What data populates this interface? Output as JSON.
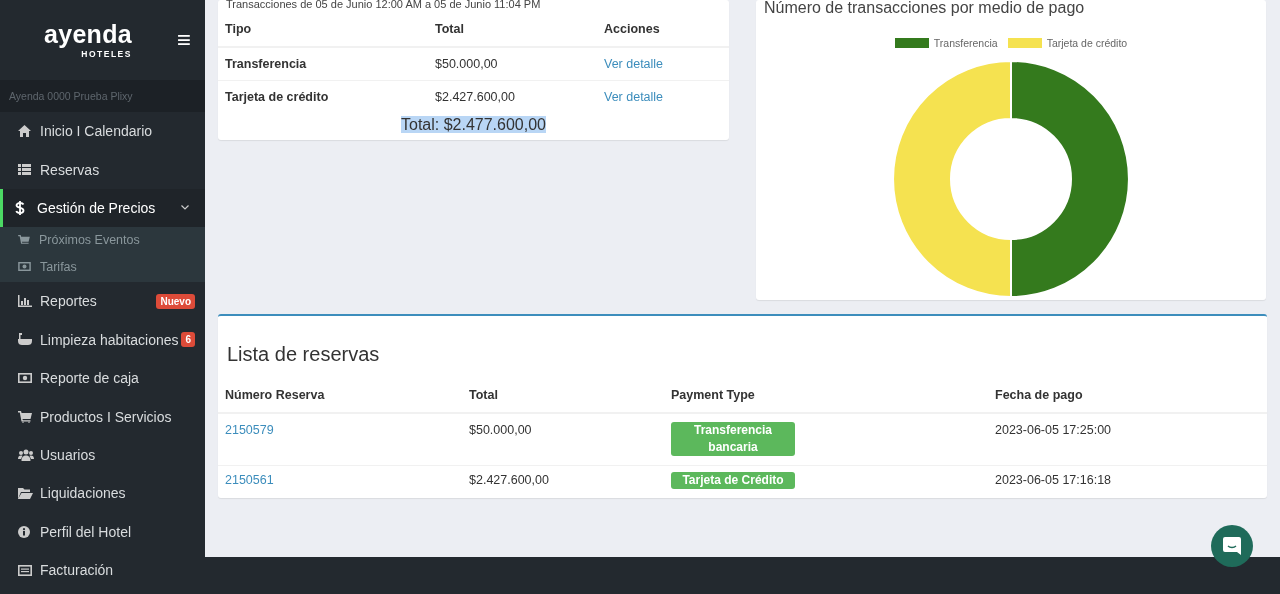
{
  "sidebar": {
    "logo": {
      "name": "ayenda",
      "sub": "HOTELES"
    },
    "menu_icon": "≡",
    "hotel": "Ayenda 0000 Prueba Plixy",
    "items": [
      {
        "label": "Inicio I Calendario",
        "selected": false
      },
      {
        "label": "Reservas",
        "selected": false
      },
      {
        "label": "Gestión de Precios",
        "selected": true,
        "expanded": true,
        "children": [
          {
            "label": "Próximos Eventos"
          },
          {
            "label": "Tarifas"
          }
        ]
      },
      {
        "label": "Reportes",
        "selected": false,
        "badge": "Nuevo"
      },
      {
        "label": "Limpieza habitaciones",
        "selected": false,
        "badge": "6"
      },
      {
        "label": "Reporte de caja",
        "selected": false
      },
      {
        "label": "Productos I Servicios",
        "selected": false
      },
      {
        "label": "Usuarios",
        "selected": false
      },
      {
        "label": "Liquidaciones",
        "selected": false
      },
      {
        "label": "Perfil del Hotel",
        "selected": false
      },
      {
        "label": "Facturación",
        "selected": false
      }
    ]
  },
  "summary": {
    "subtitle": "Transacciones de 05 de Junio 12:00 AM a 05 de Junio 11:04 PM",
    "columns": [
      "Tipo",
      "Total",
      "Acciones"
    ],
    "rows": [
      {
        "tipo": "Transferencia",
        "total": "$50.000,00",
        "action": "Ver detalle"
      },
      {
        "tipo": "Tarjeta de crédito",
        "total": "$2.427.600,00",
        "action": "Ver detalle"
      }
    ],
    "total": "Total: $2.477.600,00"
  },
  "chart": {
    "title": "Número de transacciones por medio de pago",
    "chart_data": {
      "type": "donut",
      "categories": [
        "Transferencia",
        "Tarjeta de crédito"
      ],
      "series": [
        {
          "values": [
            50,
            50
          ]
        }
      ],
      "colors": [
        "#347a1d",
        "#f5e250"
      ]
    }
  },
  "reservations": {
    "title": "Lista de reservas",
    "columns": [
      "Número Reserva",
      "Total",
      "Payment Type",
      "Fecha de pago"
    ],
    "rows": [
      {
        "number": "2150579",
        "total": "$50.000,00",
        "payment": "Transferencia bancaria",
        "date": "2023-06-05 17:25:00"
      },
      {
        "number": "2150561",
        "total": "$2.427.600,00",
        "payment": "Tarjeta de Crédito",
        "date": "2023-06-05 17:16:18"
      }
    ]
  }
}
